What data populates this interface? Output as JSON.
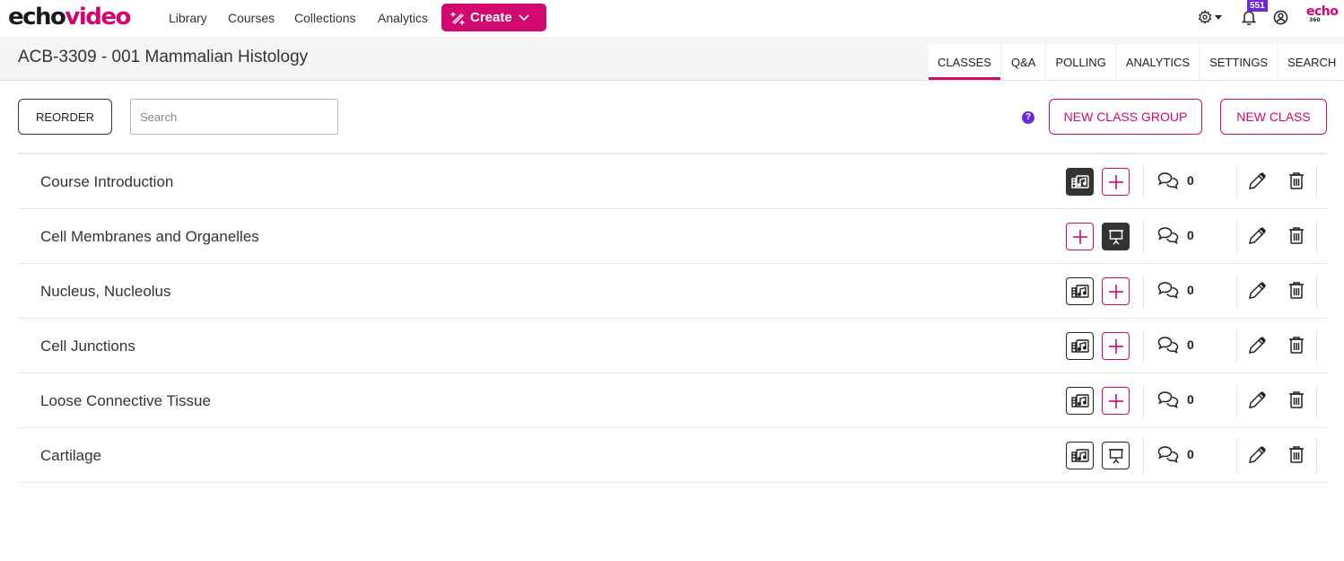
{
  "app": {
    "logo_part1": "echo",
    "logo_part2": "video",
    "brand_color": "#d0086f",
    "accent_purple": "#6a2ad8"
  },
  "nav": {
    "links": [
      "Library",
      "Courses",
      "Collections",
      "Analytics"
    ],
    "create_label": "Create",
    "notification_count": "551",
    "echo360_logo": "echo",
    "echo360_sub": "360"
  },
  "course": {
    "title": "ACB-3309 - 001 Mammalian Histology"
  },
  "tabs": [
    {
      "label": "CLASSES",
      "active": true
    },
    {
      "label": "Q&A",
      "active": false
    },
    {
      "label": "POLLING",
      "active": false
    },
    {
      "label": "ANALYTICS",
      "active": false
    },
    {
      "label": "SETTINGS",
      "active": false
    },
    {
      "label": "SEARCH",
      "active": false
    }
  ],
  "toolbar": {
    "reorder_label": "REORDER",
    "search_placeholder": "Search",
    "search_value": "",
    "help_label": "?",
    "new_class_group_label": "NEW CLASS GROUP",
    "new_class_label": "NEW CLASS"
  },
  "classes": [
    {
      "name": "Course Introduction",
      "slot1": "media-filled",
      "slot2": "add",
      "comments": "0"
    },
    {
      "name": "Cell Membranes and Organelles",
      "slot1": "add",
      "slot2": "presentation-filled",
      "comments": "0"
    },
    {
      "name": "Nucleus, Nucleolus",
      "slot1": "media",
      "slot2": "add",
      "comments": "0"
    },
    {
      "name": "Cell Junctions",
      "slot1": "media",
      "slot2": "add",
      "comments": "0"
    },
    {
      "name": "Loose Connective Tissue",
      "slot1": "media",
      "slot2": "add",
      "comments": "0"
    },
    {
      "name": "Cartilage",
      "slot1": "media",
      "slot2": "presentation",
      "comments": "0"
    }
  ]
}
